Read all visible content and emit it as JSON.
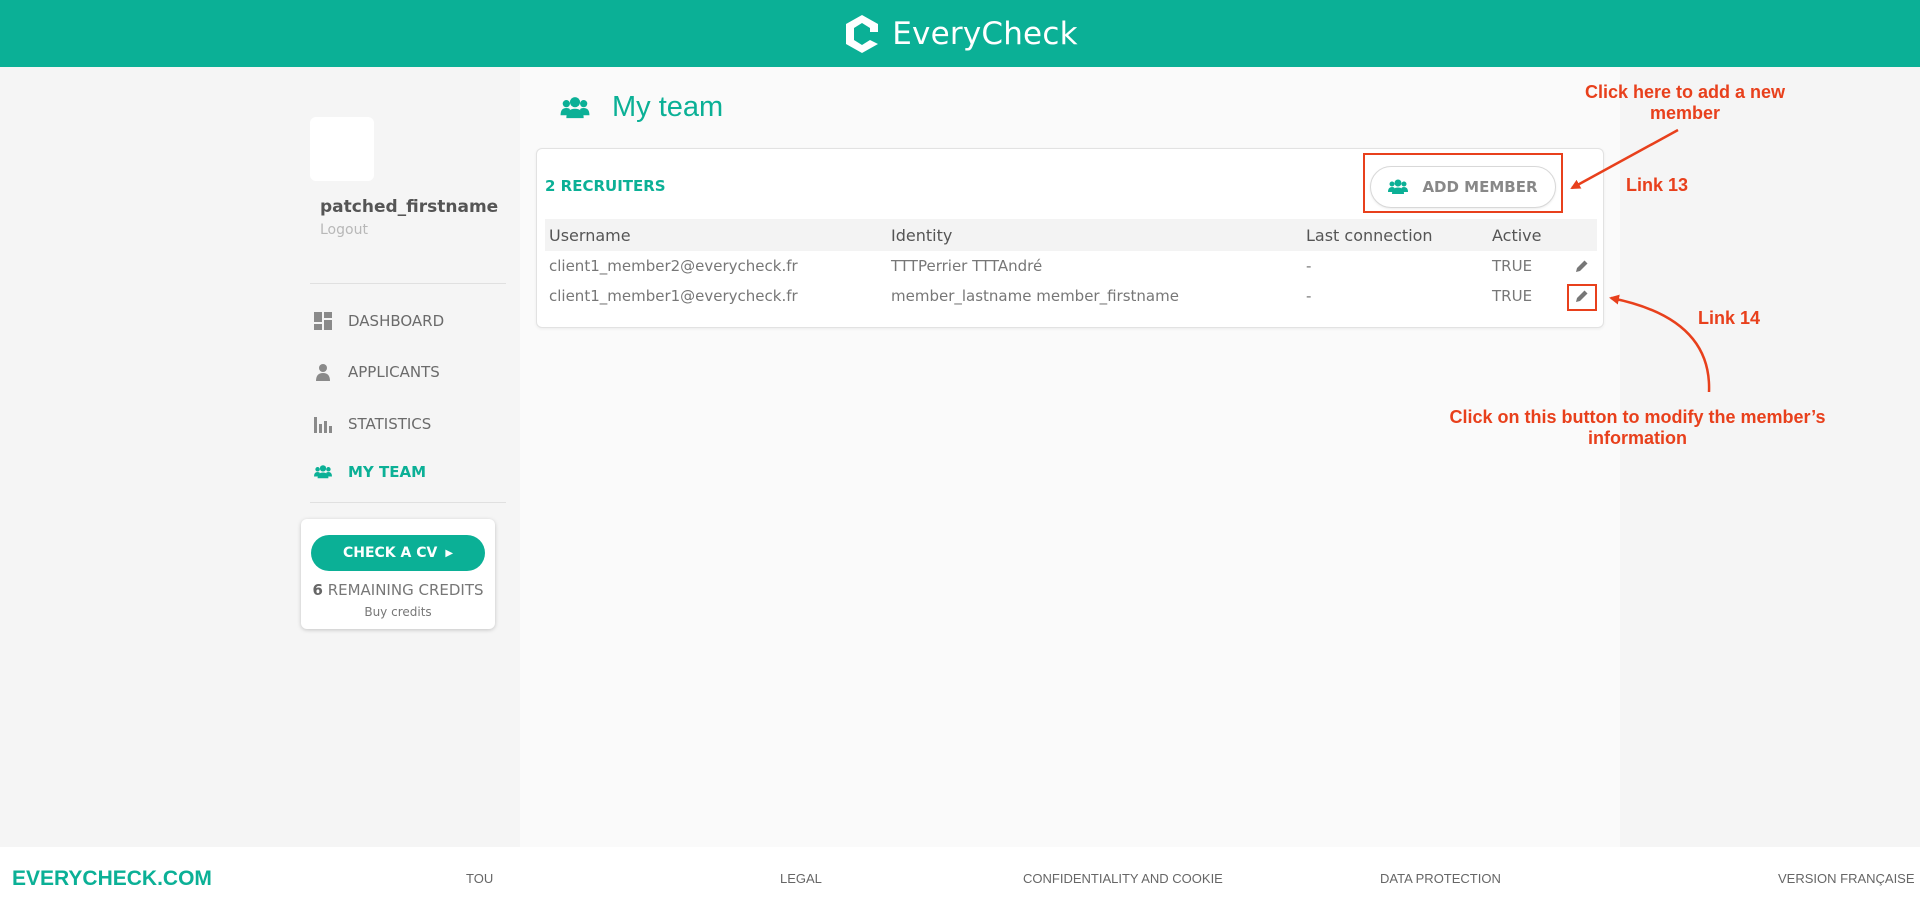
{
  "header": {
    "brand": "EveryCheck"
  },
  "sidebar": {
    "user_name": "patched_firstname",
    "logout": "Logout",
    "nav": [
      {
        "label": "DASHBOARD",
        "icon": "dashboard-icon"
      },
      {
        "label": "APPLICANTS",
        "icon": "user-icon"
      },
      {
        "label": "STATISTICS",
        "icon": "bar-chart-icon"
      },
      {
        "label": "MY TEAM",
        "icon": "team-icon",
        "active": true
      }
    ],
    "cv_card": {
      "button": "CHECK A CV",
      "credits_count": "6",
      "credits_label": "REMAINING CREDITS",
      "buy": "Buy credits"
    }
  },
  "main": {
    "title": "My team",
    "recruiters": "2 RECRUITERS",
    "add_member": "ADD MEMBER",
    "table": {
      "headers": [
        "Username",
        "Identity",
        "Last connection",
        "Active"
      ],
      "rows": [
        [
          "client1_member2@everycheck.fr",
          "TTTPerrier TTTAndré",
          "-",
          "TRUE"
        ],
        [
          "client1_member1@everycheck.fr",
          "member_lastname member_firstname",
          "-",
          "TRUE"
        ]
      ]
    }
  },
  "annotations": {
    "add_note": "Click here to add a new member",
    "link13": "Link 13",
    "link14": "Link 14",
    "edit_note": "Click on this button to modify the member’s information"
  },
  "footer": {
    "logo": "EVERYCHECK.COM",
    "links": [
      "TOU",
      "LEGAL",
      "CONFIDENTIALITY AND COOKIE",
      "DATA PROTECTION",
      "VERSION FRANÇAISE"
    ]
  },
  "colors": {
    "brand": "#0bb096",
    "annotation": "#e8401c"
  }
}
